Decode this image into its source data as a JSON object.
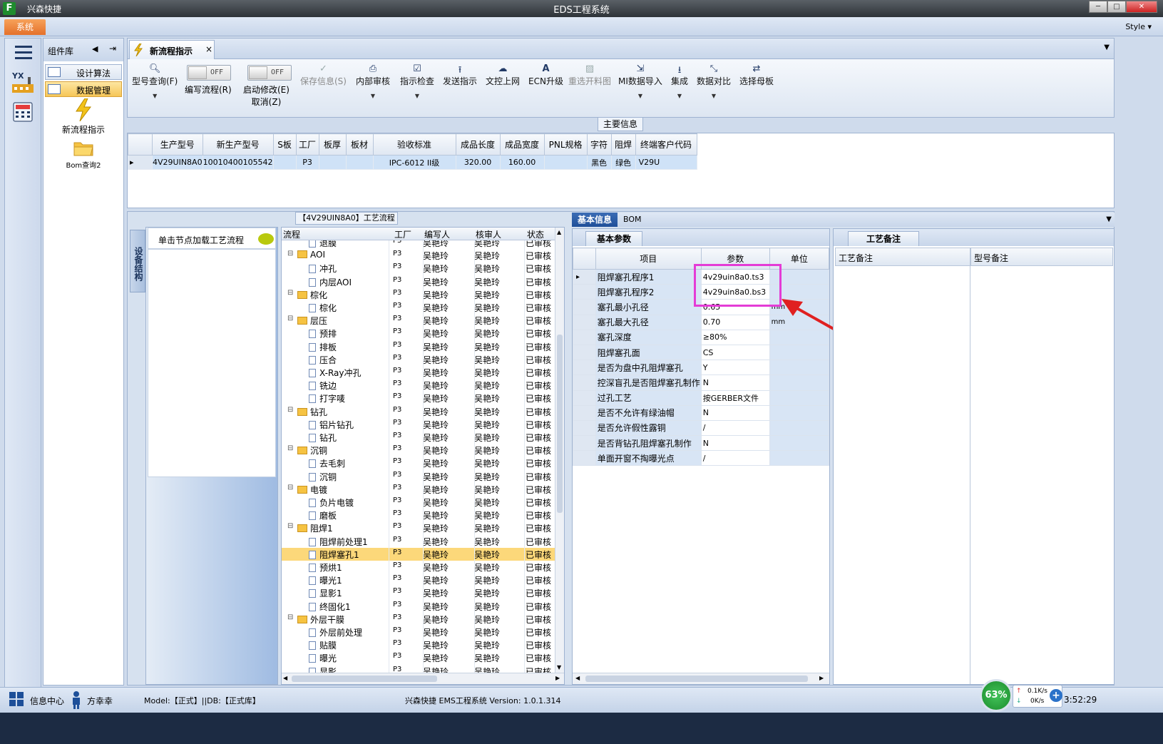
{
  "window": {
    "app_name": "兴森快捷",
    "title": "EDS工程系统",
    "min": "─",
    "max": "□",
    "close": "✕"
  },
  "menubar": {
    "system_tab": "系统",
    "style_label": "Style"
  },
  "left_panel": {
    "title": "组件库",
    "items": [
      {
        "label": "设计算法"
      },
      {
        "label": "数据管理"
      }
    ],
    "big_items": [
      {
        "label": "新流程指示",
        "icon": "lightning-icon"
      },
      {
        "label": "Bom查询2",
        "icon": "folder-icon"
      }
    ]
  },
  "doc_tab": {
    "label": "新流程指示",
    "close": "×"
  },
  "toolbar": {
    "items": [
      {
        "label": "型号查询(F)",
        "icon": "search-icon",
        "has_dropdown": true,
        "disabled": false
      },
      {
        "label": "编写流程(R)",
        "toggle": "OFF"
      },
      {
        "label": "启动修改(E)",
        "label2": "取消(Z)",
        "toggle": "OFF"
      },
      {
        "label": "保存信息(S)",
        "icon": "check-icon",
        "disabled": true
      },
      {
        "label": "内部审核",
        "icon": "print-icon",
        "has_dropdown": true
      },
      {
        "label": "指示检查",
        "icon": "checklist-icon",
        "has_dropdown": true
      },
      {
        "label": "发送指示",
        "icon": "upload-icon"
      },
      {
        "label": "文控上网",
        "icon": "cloud-icon"
      },
      {
        "label": "ECN升级",
        "icon": "ecn-icon"
      },
      {
        "label": "重选开料图",
        "icon": "image-icon",
        "disabled": true
      },
      {
        "label": "MI数据导入",
        "icon": "import-icon",
        "has_dropdown": true
      },
      {
        "label": "集成",
        "icon": "download-icon",
        "has_dropdown": true
      },
      {
        "label": "数据对比",
        "icon": "compare-icon",
        "has_dropdown": true
      },
      {
        "label": "选择母板",
        "icon": "shuffle-icon"
      }
    ]
  },
  "main_info": {
    "label": "主要信息",
    "columns": [
      "生产型号",
      "新生产型号",
      "S板",
      "工厂",
      "板厚",
      "板材",
      "验收标准",
      "成品长度",
      "成品宽度",
      "PNL规格",
      "字符",
      "阻焊",
      "终端客户代码"
    ],
    "row": [
      "4V29UIN8A0",
      "10010400105542",
      "",
      "P3",
      "",
      "",
      "IPC-6012 II级",
      "320.00",
      "160.00",
      "",
      "黑色",
      "绿色",
      "V29U"
    ]
  },
  "flow": {
    "title": "【4V29UIN8A0】工艺流程",
    "side_tab": "设备结构",
    "load_text": "单击节点加载工艺流程",
    "columns": [
      "流程",
      "工厂",
      "编写人",
      "核审人",
      "状态"
    ],
    "rows": [
      {
        "name": "退膜",
        "level": 2,
        "folder": false
      },
      {
        "name": "AOI",
        "level": 1,
        "folder": true
      },
      {
        "name": "冲孔",
        "level": 2,
        "folder": false
      },
      {
        "name": "内层AOI",
        "level": 2,
        "folder": false
      },
      {
        "name": "棕化",
        "level": 1,
        "folder": true
      },
      {
        "name": "棕化",
        "level": 2,
        "folder": false
      },
      {
        "name": "层压",
        "level": 1,
        "folder": true
      },
      {
        "name": "预排",
        "level": 2,
        "folder": false
      },
      {
        "name": "排板",
        "level": 2,
        "folder": false
      },
      {
        "name": "压合",
        "level": 2,
        "folder": false
      },
      {
        "name": "X-Ray冲孔",
        "level": 2,
        "folder": false
      },
      {
        "name": "铣边",
        "level": 2,
        "folder": false
      },
      {
        "name": "打字唛",
        "level": 2,
        "folder": false
      },
      {
        "name": "钻孔",
        "level": 1,
        "folder": true
      },
      {
        "name": "铝片钻孔",
        "level": 2,
        "folder": false
      },
      {
        "name": "钻孔",
        "level": 2,
        "folder": false
      },
      {
        "name": "沉铜",
        "level": 1,
        "folder": true
      },
      {
        "name": "去毛刺",
        "level": 2,
        "folder": false
      },
      {
        "name": "沉铜",
        "level": 2,
        "folder": false
      },
      {
        "name": "电镀",
        "level": 1,
        "folder": true
      },
      {
        "name": "负片电镀",
        "level": 2,
        "folder": false
      },
      {
        "name": "磨板",
        "level": 2,
        "folder": false
      },
      {
        "name": "阻焊1",
        "level": 1,
        "folder": true
      },
      {
        "name": "阻焊前处理1",
        "level": 2,
        "folder": false
      },
      {
        "name": "阻焊塞孔1",
        "level": 2,
        "folder": false,
        "selected": true
      },
      {
        "name": "预烘1",
        "level": 2,
        "folder": false
      },
      {
        "name": "曝光1",
        "level": 2,
        "folder": false
      },
      {
        "name": "显影1",
        "level": 2,
        "folder": false
      },
      {
        "name": "终固化1",
        "level": 2,
        "folder": false
      },
      {
        "name": "外层干膜",
        "level": 1,
        "folder": true
      },
      {
        "name": "外层前处理",
        "level": 2,
        "folder": false
      },
      {
        "name": "贴膜",
        "level": 2,
        "folder": false
      },
      {
        "name": "曝光",
        "level": 2,
        "folder": false
      },
      {
        "name": "显影",
        "level": 2,
        "folder": false
      }
    ],
    "factory": "P3",
    "writer": "吴艳玲",
    "reviewer": "吴艳玲",
    "status": "已审核"
  },
  "right_tabs": {
    "active": "基本信息",
    "other": "BOM"
  },
  "basic_params": {
    "tab": "基本参数",
    "columns": [
      "项目",
      "参数",
      "单位"
    ],
    "rows": [
      {
        "k": "阻焊塞孔程序1",
        "v": "4v29uin8a0.ts3",
        "u": ""
      },
      {
        "k": "阻焊塞孔程序2",
        "v": "4v29uin8a0.bs3",
        "u": ""
      },
      {
        "k": "塞孔最小孔径",
        "v": "0.65",
        "u": "mm"
      },
      {
        "k": "塞孔最大孔径",
        "v": "0.70",
        "u": "mm"
      },
      {
        "k": "塞孔深度",
        "v": "≥80%",
        "u": ""
      },
      {
        "k": "阻焊塞孔面",
        "v": "CS",
        "u": ""
      },
      {
        "k": "是否为盘中孔阻焊塞孔",
        "v": "Y",
        "u": ""
      },
      {
        "k": "控深盲孔是否阻焊塞孔制作",
        "v": "N",
        "u": ""
      },
      {
        "k": "过孔工艺",
        "v": "按GERBER文件",
        "u": ""
      },
      {
        "k": "是否不允许有绿油帽",
        "v": "N",
        "u": ""
      },
      {
        "k": "是否允许假性露铜",
        "v": "/",
        "u": ""
      },
      {
        "k": "是否背钻孔阻焊塞孔制作",
        "v": "N",
        "u": ""
      },
      {
        "k": "单面开窗不掏曝光点",
        "v": "/",
        "u": ""
      }
    ]
  },
  "remarks": {
    "tab": "工艺备注",
    "col1": "工艺备注",
    "col2": "型号备注"
  },
  "statusbar": {
    "info_center": "信息中心",
    "user": "方幸幸",
    "model_db": "Model:【正式】||DB:【正式库】",
    "version": "兴森快捷 EMS工程系统 Version: 1.0.1.314",
    "cpu": "63%",
    "net_up": "0.1K/s",
    "net_down": "0K/s",
    "time": "3:52:29"
  },
  "colors": {
    "accent": "#e4702a",
    "selection": "#fcd87a",
    "highlight": "#e43cd6",
    "arrow": "#e02020"
  }
}
